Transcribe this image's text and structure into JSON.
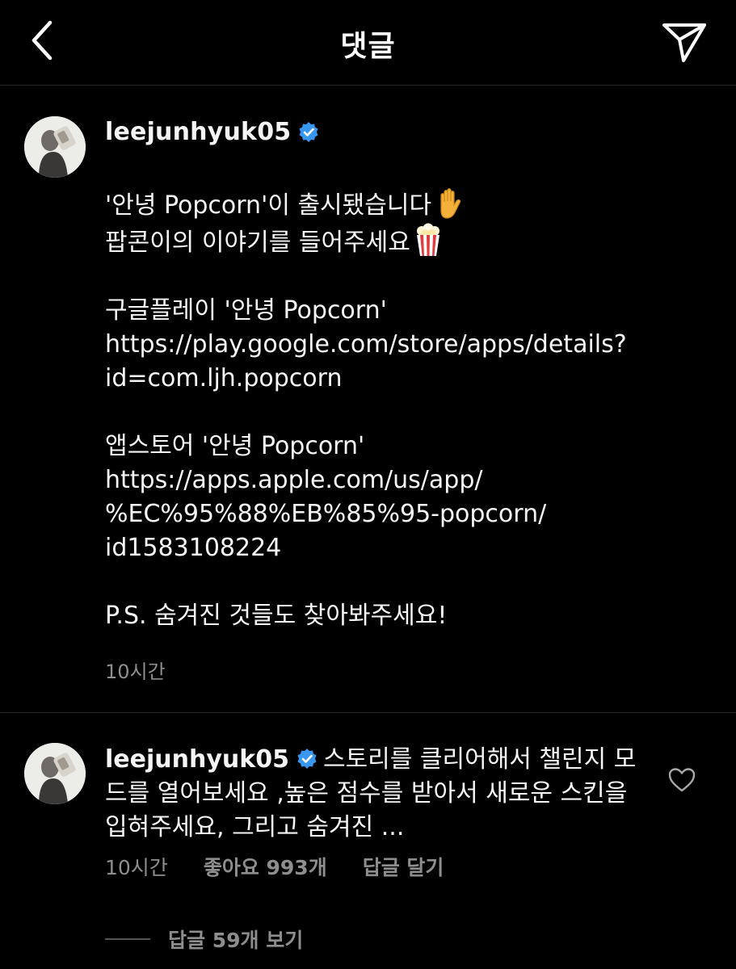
{
  "header": {
    "title": "댓글",
    "back_icon": "chevron-left-icon",
    "share_icon": "paper-plane-icon"
  },
  "post": {
    "username": "leejunhyuk05",
    "verified": true,
    "caption_lines": [
      "'안녕 Popcorn'이 출시됐습니다",
      "팝콘이의 이야기를 들어주세요",
      "",
      "구글플레이 '안녕 Popcorn'",
      "https://play.google.com/store/apps/details?",
      "id=com.ljh.popcorn",
      "",
      "앱스토어 '안녕 Popcorn'",
      "https://apps.apple.com/us/app/",
      "%EC%95%88%EB%85%95-popcorn/",
      "id1583108224",
      "",
      "P.S. 숨겨진 것들도 찾아봐주세요!"
    ],
    "time": "10시간"
  },
  "comment": {
    "username": "leejunhyuk05",
    "verified": true,
    "text": "스토리를 클리어해서 챌린지 모드를 열어보세요 ,높은 점수를 받아서 새로운 스킨을 입혀주세요, 그리고 숨겨진 ...",
    "time": "10시간",
    "likes": "좋아요 993개",
    "reply_label": "답글 달기",
    "view_replies": "답글 59개 보기"
  },
  "colors": {
    "background": "#000000",
    "text": "#f5f5f5",
    "secondary": "#8e8e8e",
    "verified_blue": "#3897f0"
  }
}
